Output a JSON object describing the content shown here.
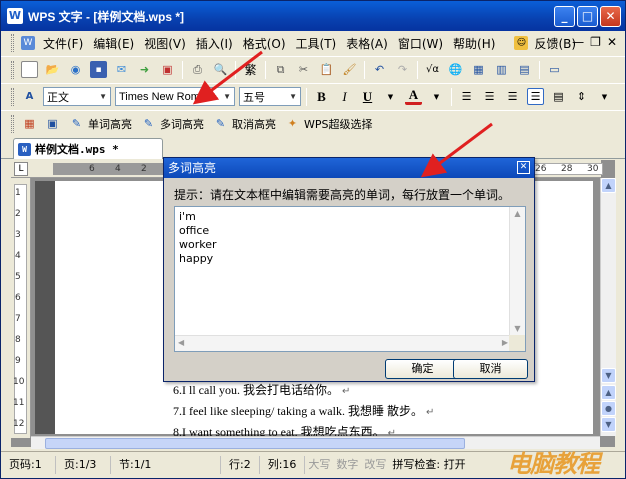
{
  "window": {
    "title": "WPS 文字 - [样例文档.wps *]",
    "app_icon": "wps-writer-icon"
  },
  "menu": {
    "items": [
      "文件(F)",
      "编辑(E)",
      "视图(V)",
      "插入(I)",
      "格式(O)",
      "工具(T)",
      "表格(A)",
      "窗口(W)",
      "帮助(H)"
    ],
    "feedback": "反馈(B)"
  },
  "format_toolbar": {
    "style": "正文",
    "font": "Times New Roman",
    "size": "五号",
    "bold": "B",
    "italic": "I",
    "underline": "U",
    "font_color": "A"
  },
  "custom_toolbar": {
    "word_highlight": "单词高亮",
    "multi_highlight": "多词高亮",
    "cancel_highlight": "取消高亮",
    "super_select": "WPS超级选择"
  },
  "document_tab": {
    "label": "样例文档.wps *"
  },
  "ruler": {
    "h_numbers": [
      "6",
      "4",
      "2"
    ],
    "h_numbers_right": [
      "26",
      "28",
      "30"
    ],
    "v_numbers": [
      "1",
      "2",
      "3",
      "4",
      "5",
      "6",
      "7",
      "8",
      "9",
      "10",
      "11",
      "12"
    ]
  },
  "document": {
    "lines": [
      "6.I   ll call you. 我会打电话给你。",
      "7.I feel like sleeping/ taking a walk. 我想睡 散步。",
      "8.I want something to eat. 我想吃点东西。"
    ]
  },
  "dialog": {
    "title": "多词高亮",
    "hint": "提示：请在文本框中编辑需要高亮的单词，每行放置一个单词。",
    "words": [
      "i'm",
      "office",
      "worker",
      "happy"
    ],
    "ok": "确定",
    "cancel": "取消"
  },
  "status": {
    "page": "页码:1",
    "pages": "页:1/3",
    "section": "节:1/1",
    "row": "行:2",
    "col": "列:16",
    "caps": "大写",
    "num": "数字",
    "overwrite": "改写",
    "spell": "拼写检查: 打开"
  },
  "watermark": "电脑教程",
  "colors": {
    "title_blue": "#0a5fd8",
    "arrow_red": "#e02020",
    "watermark": "#e8a23a"
  }
}
